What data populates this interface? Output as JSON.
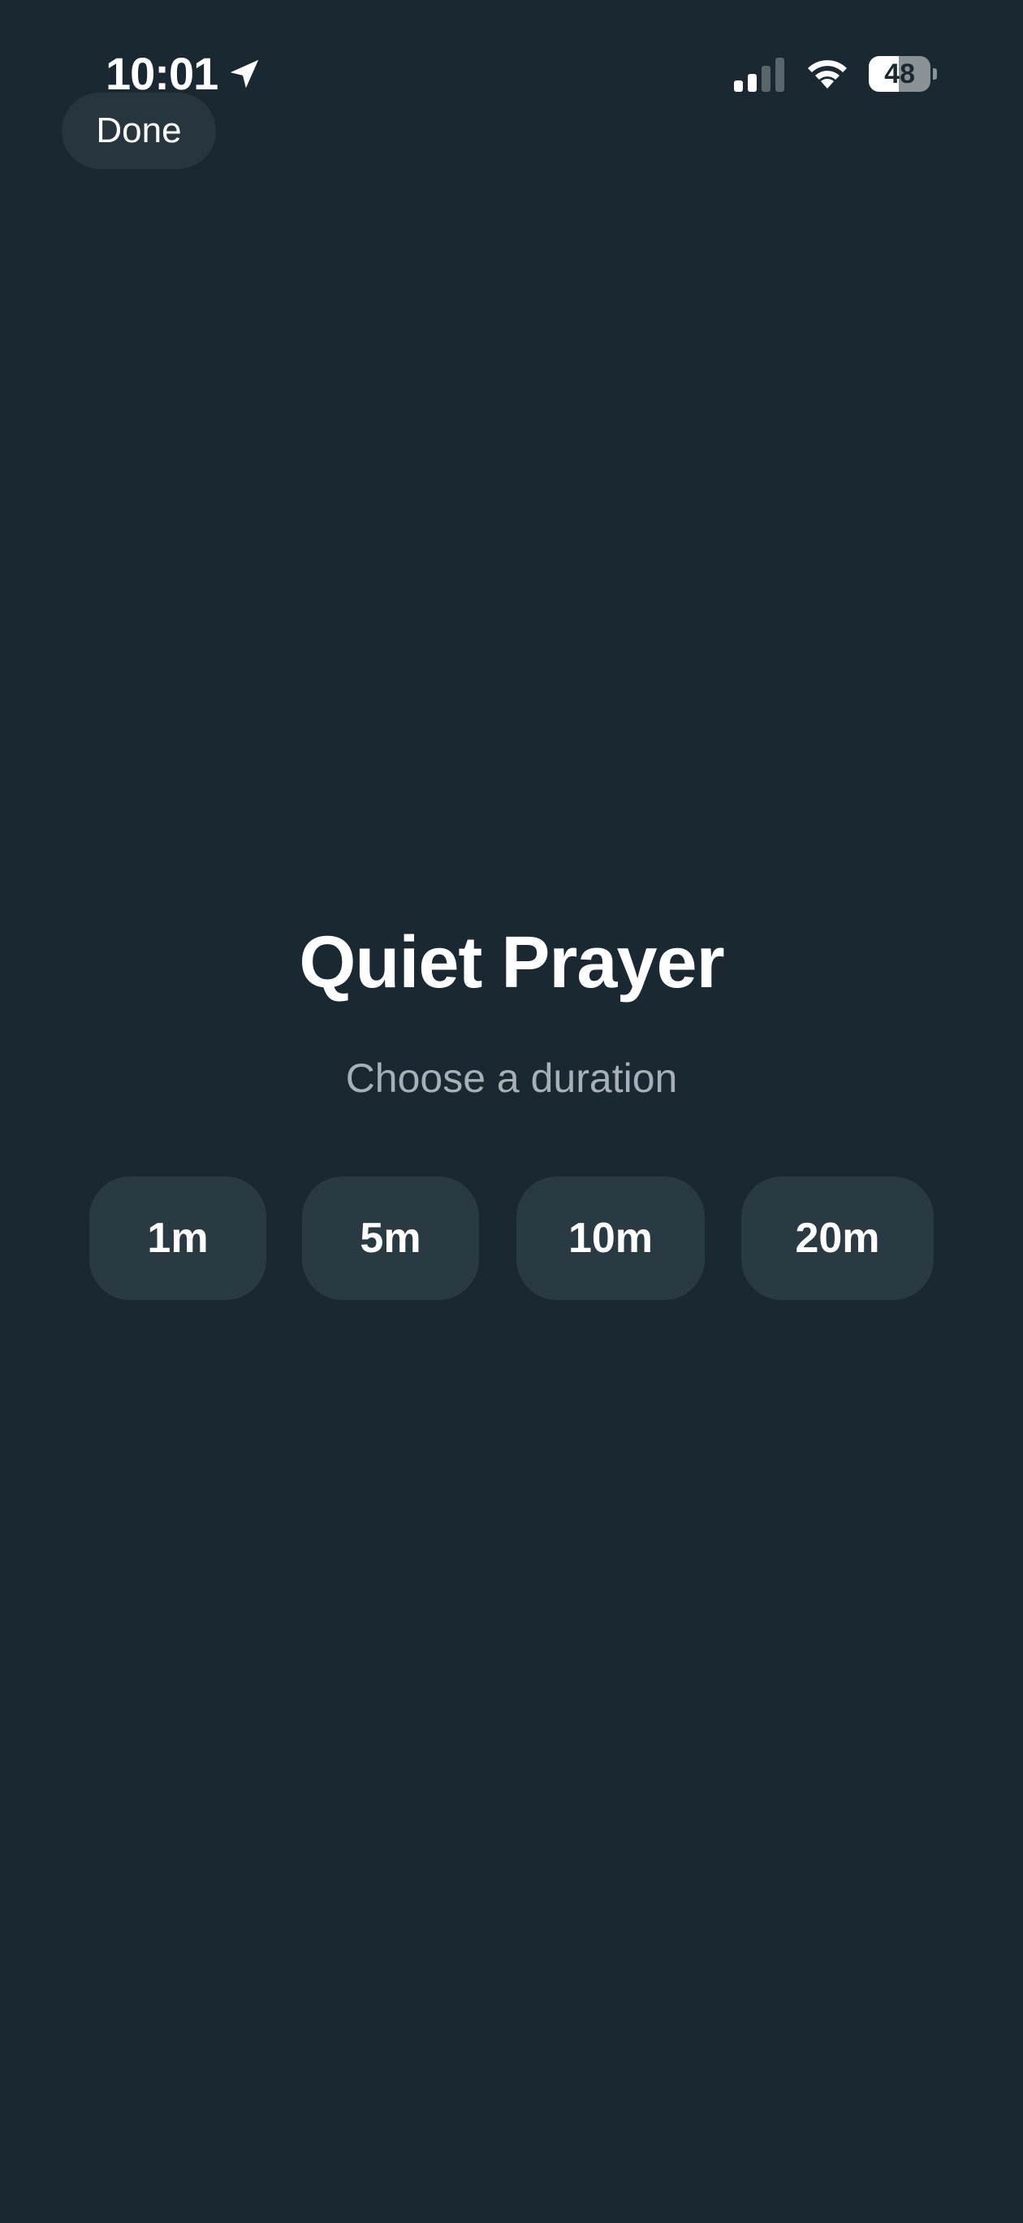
{
  "status_bar": {
    "time": "10:01",
    "location_icon": "location-arrow-icon",
    "signal_icon": "cellular-signal-icon",
    "wifi_icon": "wifi-icon",
    "battery_level": "48",
    "battery_fraction": 0.48
  },
  "nav": {
    "done_label": "Done"
  },
  "main": {
    "title": "Quiet Prayer",
    "subtitle": "Choose a duration",
    "durations": [
      {
        "label": "1m"
      },
      {
        "label": "5m"
      },
      {
        "label": "10m"
      },
      {
        "label": "20m"
      }
    ]
  },
  "colors": {
    "background": "#1a2931",
    "button": "#2a3a42",
    "text": "#ffffff",
    "subtitle": "#a6b0b5"
  }
}
